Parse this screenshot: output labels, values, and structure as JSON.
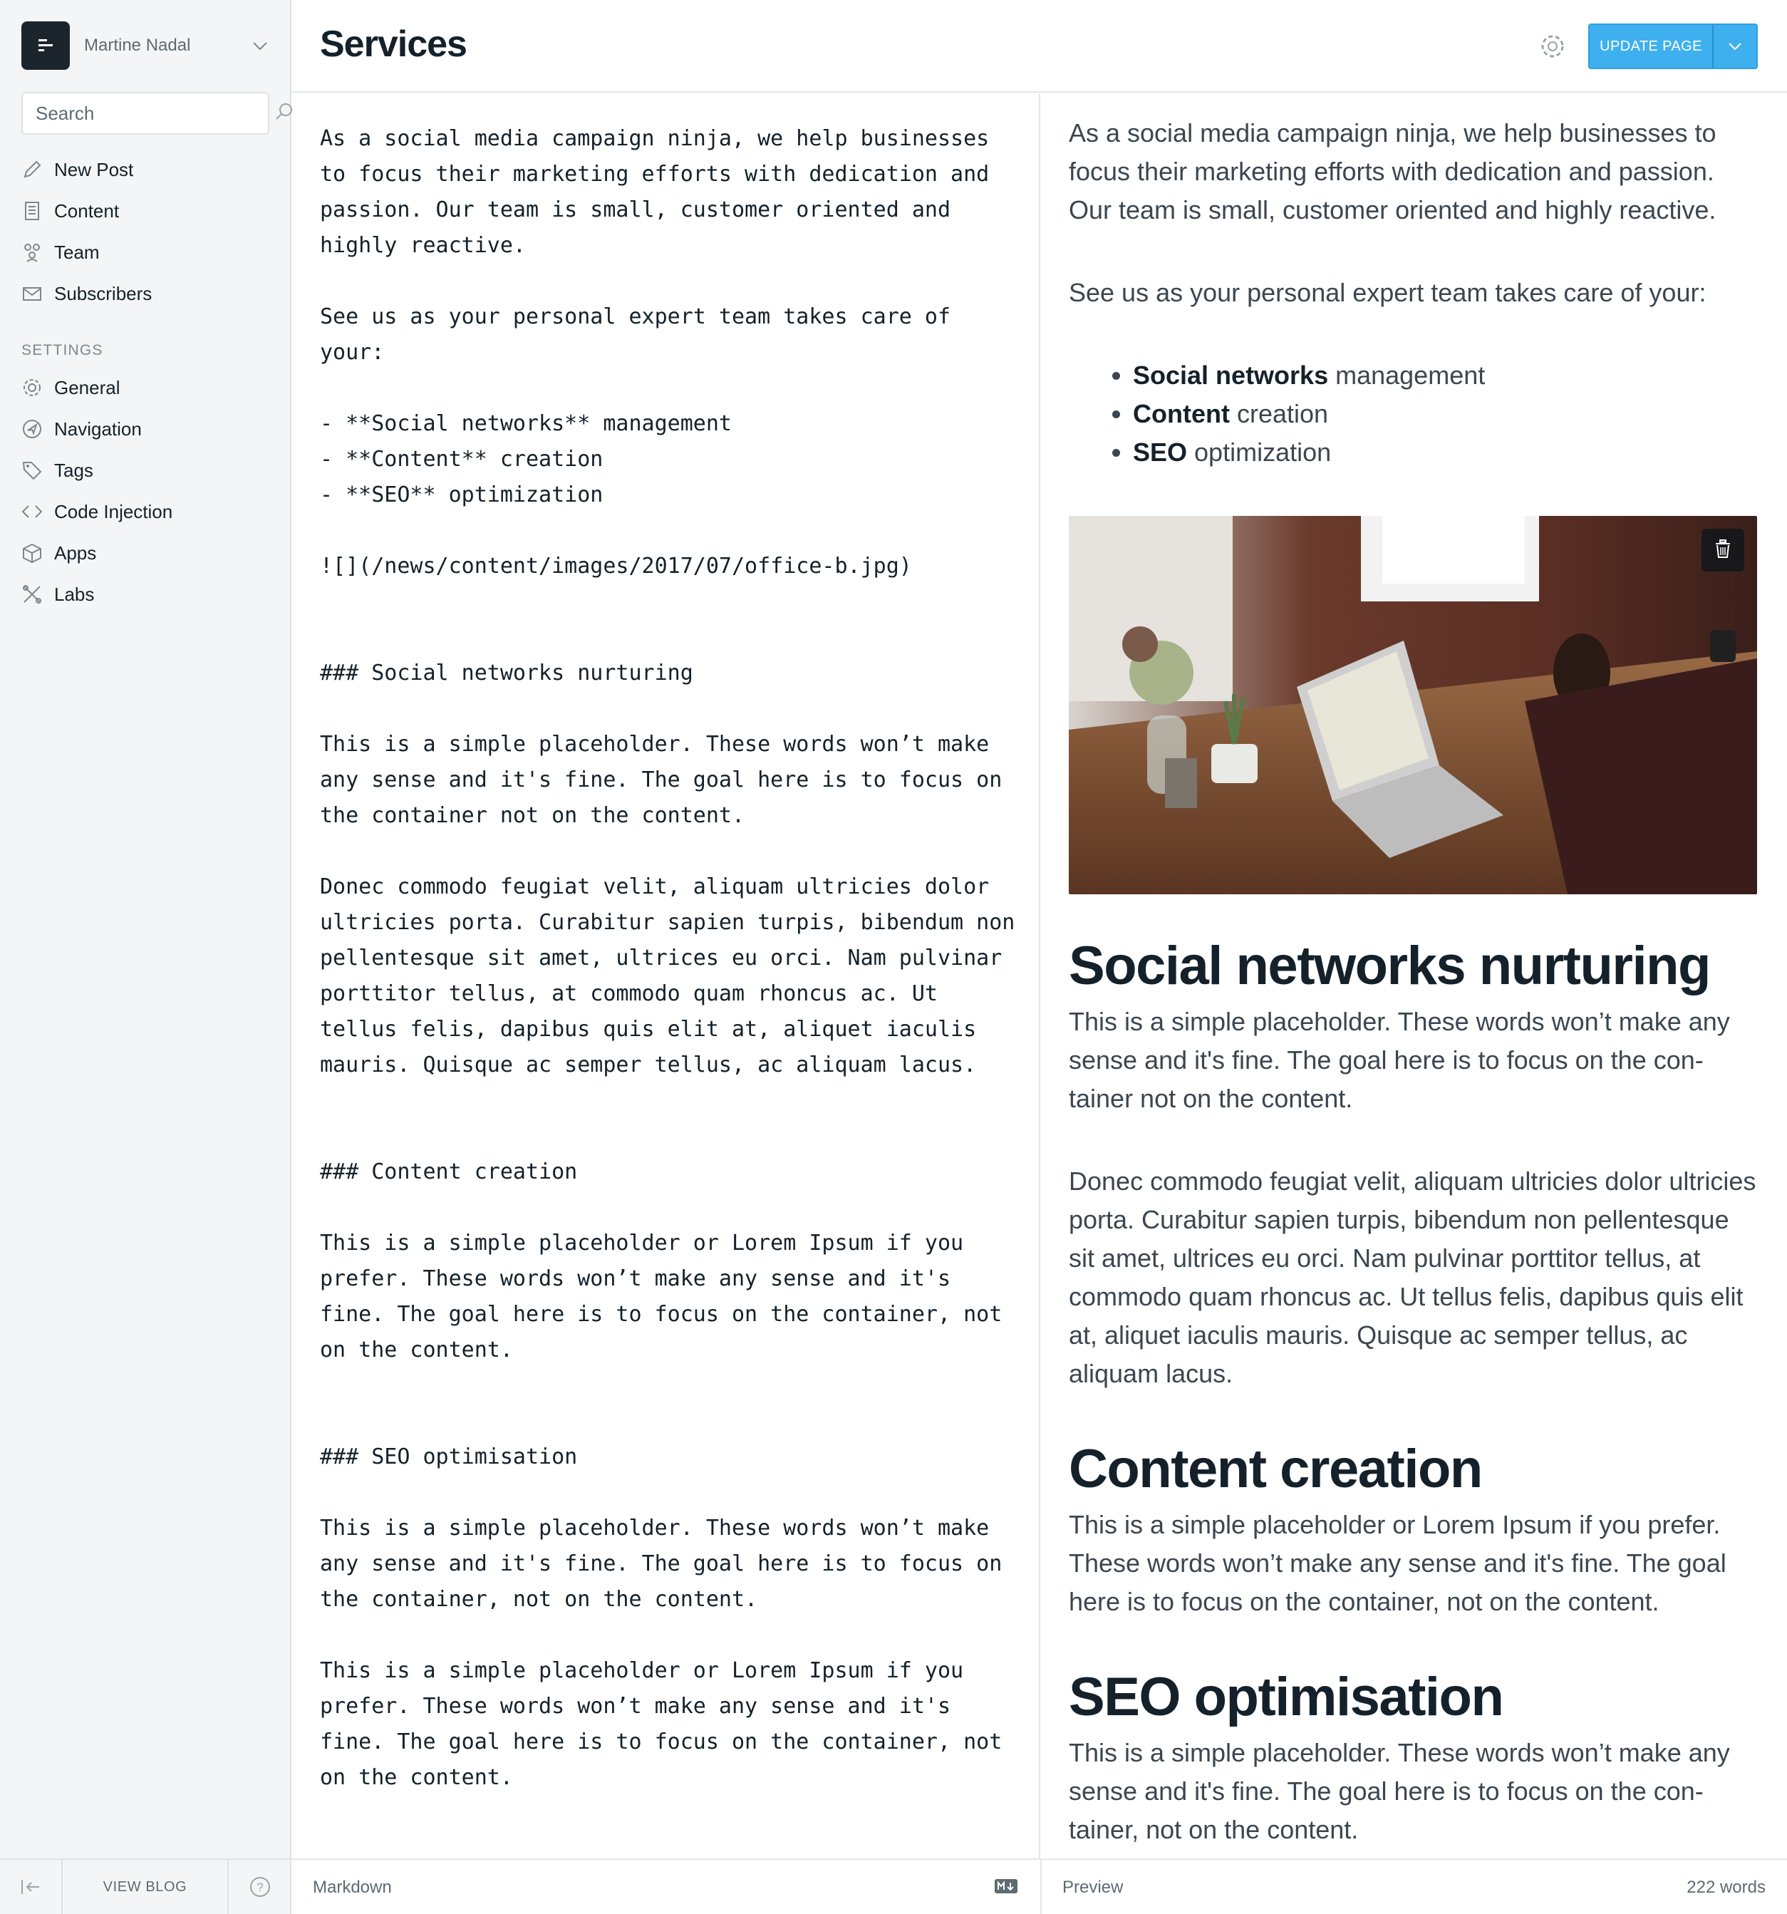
{
  "sidebar": {
    "blog_name": "Martine Nadal",
    "search_placeholder": "Search",
    "main_items": [
      {
        "label": "New Post",
        "icon": "pen-icon"
      },
      {
        "label": "Content",
        "icon": "document-icon"
      },
      {
        "label": "Team",
        "icon": "team-icon"
      },
      {
        "label": "Subscribers",
        "icon": "mail-icon"
      }
    ],
    "settings_title": "SETTINGS",
    "settings_items": [
      {
        "label": "General",
        "icon": "gear-icon"
      },
      {
        "label": "Navigation",
        "icon": "compass-icon"
      },
      {
        "label": "Tags",
        "icon": "tag-icon"
      },
      {
        "label": "Code Injection",
        "icon": "code-icon"
      },
      {
        "label": "Apps",
        "icon": "box-icon"
      },
      {
        "label": "Labs",
        "icon": "labs-icon"
      }
    ],
    "view_blog": "VIEW BLOG"
  },
  "header": {
    "title": "Services",
    "update_button": "UPDATE PAGE"
  },
  "markdown": {
    "text": "As a social media campaign ninja, we help businesses to focus their marketing efforts with dedication and passion. Our team is small, customer oriented and highly reactive.\n\nSee us as your personal expert team takes care of your:\n\n- **Social networks** management\n- **Content** creation\n- **SEO** optimization\n\n![](/news/content/images/2017/07/office-b.jpg)\n\n\n### Social networks nurturing\n\nThis is a simple placeholder. These words won’t make any sense and it's fine. The goal here is to focus on the container not on the content.\n\nDonec commodo feugiat velit, aliquam ultricies dolor ultricies porta. Curabitur sapien turpis, bibendum non pellentesque sit amet, ultrices eu orci. Nam pulvinar porttitor tellus, at commodo quam rhoncus ac. Ut tellus felis, dapibus quis elit at, aliquet iaculis mauris. Quisque ac semper tellus, ac aliquam lacus.\n\n\n### Content creation\n\nThis is a simple placeholder or Lorem Ipsum if you prefer. These words won’t make any sense and it's fine. The goal here is to focus on the container, not on the content.\n\n\n### SEO optimisation\n\nThis is a simple placeholder. These words won’t make any sense and it's fine. The goal here is to focus on the container, not on the content.\n\nThis is a simple placeholder or Lorem Ipsum if you prefer. These words won’t make any sense and it's fine. The goal here is to focus on the container, not on the content.\n\n\n<br><a href=\"/news/portfolio/\" class=\"button button-"
  },
  "preview": {
    "intro": "As a social media campaign ninja, we help businesses to focus their marketing efforts with dedication and passion. Our team is small, customer oriented and highly reactive.",
    "lead": "See us as your personal expert team takes care of your:",
    "list": [
      {
        "bold": "Social networks",
        "rest": " management"
      },
      {
        "bold": "Content",
        "rest": " creation"
      },
      {
        "bold": "SEO",
        "rest": " optimization"
      }
    ],
    "h_social": "Social networks nurturing",
    "p_social_1": "This is a simple placeholder. These words won’t make any sense and it's fine. The goal here is to focus on the con­tainer not on the content.",
    "p_social_2": "Donec commodo feugiat velit, aliquam ultricies dolor ul­tricies porta. Curabitur sapien turpis, bibendum non pel­lentesque sit amet, ultrices eu orci. Nam pulvinar porttitor tellus, at commodo quam rhoncus ac. Ut tellus felis, dapibus quis elit at, aliquet iaculis mauris. Quisque ac semper tellus, ac aliquam lacus.",
    "h_content": "Content creation",
    "p_content": "This is a simple placeholder or Lorem Ipsum if you prefer. These words won’t make any sense and it's fine. The goal here is to focus on the container, not on the content.",
    "h_seo": "SEO optimisation",
    "p_seo": "This is a simple placeholder. These words won’t make any sense and it's fine. The goal here is to focus on the con­tainer, not on the content."
  },
  "footer": {
    "markdown_label": "Markdown",
    "preview_label": "Preview",
    "word_count": "222 words"
  },
  "colors": {
    "accent": "#3eb0ef",
    "sidebar_bg": "#f4f5f6",
    "text_dark": "#15212a"
  }
}
